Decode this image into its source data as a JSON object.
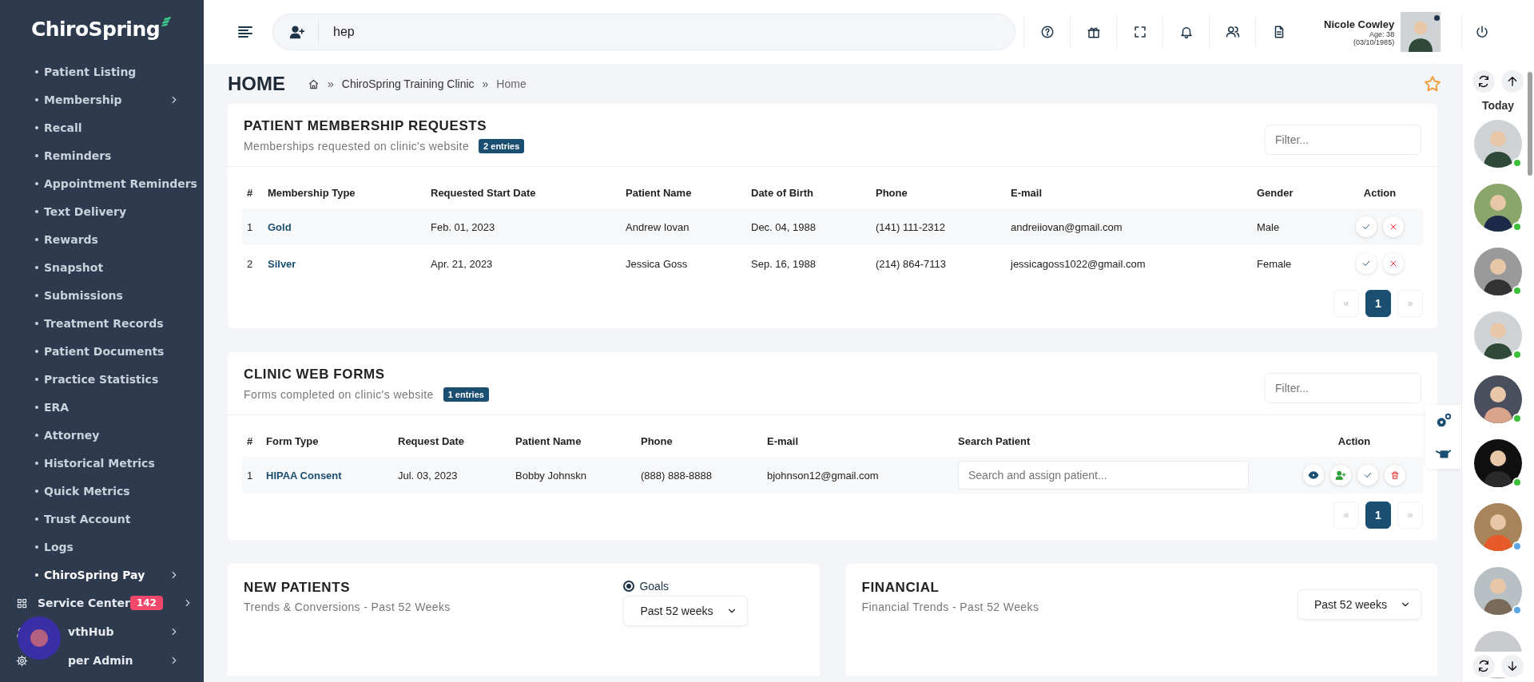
{
  "sidebar": {
    "logo": "ChiroSpring",
    "items": [
      {
        "kind": "sub",
        "label": "Patient Listing",
        "selected": false,
        "submenu": false
      },
      {
        "kind": "sub",
        "label": "Membership",
        "selected": false,
        "submenu": true
      },
      {
        "kind": "sub",
        "label": "Recall",
        "selected": false,
        "submenu": false
      },
      {
        "kind": "sub",
        "label": "Reminders",
        "selected": false,
        "submenu": false
      },
      {
        "kind": "sub",
        "label": "Appointment Reminders",
        "selected": false,
        "submenu": false
      },
      {
        "kind": "sub",
        "label": "Text Delivery",
        "selected": false,
        "submenu": false
      },
      {
        "kind": "sub",
        "label": "Rewards",
        "selected": false,
        "submenu": false
      },
      {
        "kind": "sub",
        "label": "Snapshot",
        "selected": false,
        "submenu": false
      },
      {
        "kind": "sub",
        "label": "Submissions",
        "selected": false,
        "submenu": false
      },
      {
        "kind": "sub",
        "label": "Treatment Records",
        "selected": false,
        "submenu": false
      },
      {
        "kind": "sub",
        "label": "Patient Documents",
        "selected": false,
        "submenu": false
      },
      {
        "kind": "sub",
        "label": "Practice Statistics",
        "selected": false,
        "submenu": false
      },
      {
        "kind": "sub",
        "label": "ERA",
        "selected": false,
        "submenu": false
      },
      {
        "kind": "sub",
        "label": "Attorney",
        "selected": false,
        "submenu": false
      },
      {
        "kind": "sub",
        "label": "Historical Metrics",
        "selected": false,
        "submenu": false
      },
      {
        "kind": "sub",
        "label": "Quick Metrics",
        "selected": false,
        "submenu": false
      },
      {
        "kind": "sub",
        "label": "Trust Account",
        "selected": false,
        "submenu": false
      },
      {
        "kind": "sub",
        "label": "Logs",
        "selected": false,
        "submenu": false
      },
      {
        "kind": "sub",
        "label": "ChiroSpring Pay",
        "selected": true,
        "submenu": true
      },
      {
        "kind": "grid",
        "label": "Service Center",
        "badge": "142",
        "selected": false,
        "submenu": true
      },
      {
        "kind": "person",
        "label": "vthHub",
        "selected": false,
        "submenu": true
      },
      {
        "kind": "gear",
        "label": "per Admin",
        "selected": false,
        "submenu": true
      }
    ]
  },
  "header": {
    "search": {
      "value": "hep"
    },
    "user": {
      "name": "Nicole Cowley",
      "age": "Age: 38",
      "dob": "(03/10/1985)"
    }
  },
  "page": {
    "title": "HOME",
    "breadcrumb": {
      "separator": "»",
      "items": [
        "ChiroSpring Training Clinic",
        "Home"
      ]
    }
  },
  "membership_requests": {
    "title": "PATIENT MEMBERSHIP REQUESTS",
    "subtitle": "Memberships requested on clinic's website",
    "badge": "2 entries",
    "filter": {
      "placeholder": "Filter..."
    },
    "columns": [
      "#",
      "Membership Type",
      "Requested Start Date",
      "Patient Name",
      "Date of Birth",
      "Phone",
      "E-mail",
      "Gender",
      "Action"
    ],
    "rows": [
      {
        "cells": [
          "1",
          "Gold",
          "Feb. 01, 2023",
          "Andrew Iovan",
          "Dec. 04, 1988",
          "(141) 111-2312",
          "andreiiovan@gmail.com",
          "Male"
        ]
      },
      {
        "cells": [
          "2",
          "Silver",
          "Apr. 21, 2023",
          "Jessica Goss",
          "Sep. 16, 1988",
          "(214) 864-7113",
          "jessicagoss1022@gmail.com",
          "Female"
        ]
      }
    ],
    "pagination": {
      "prev": "«",
      "next": "»",
      "pages": [
        {
          "label": "1",
          "selected": true
        }
      ]
    }
  },
  "web_forms": {
    "title": "CLINIC WEB FORMS",
    "subtitle": "Forms completed on clinic's website",
    "badge": "1 entries",
    "filter": {
      "placeholder": "Filter..."
    },
    "columns": [
      "#",
      "Form Type",
      "Request Date",
      "Patient Name",
      "Phone",
      "E-mail",
      "Search Patient",
      "Action"
    ],
    "rows": [
      {
        "cells": [
          "1",
          "HIPAA Consent",
          "Jul. 03, 2023",
          "Bobby Johnskn",
          "(888) 888-8888",
          "bjohnson12@gmail.com"
        ],
        "search": {
          "placeholder": "Search and assign patient..."
        }
      }
    ],
    "pagination": {
      "prev": "«",
      "next": "»",
      "pages": [
        {
          "label": "1",
          "selected": true
        }
      ]
    }
  },
  "new_patients": {
    "title": "NEW PATIENTS",
    "subtitle": "Trends & Conversions - Past 52 Weeks",
    "goals": {
      "label": "Goals",
      "checked": true
    },
    "period": "Past 52 weeks"
  },
  "financial": {
    "title": "FINANCIAL",
    "subtitle": "Financial Trends - Past 52 Weeks",
    "period": "Past 52 weeks"
  },
  "rail": {
    "label": "Today"
  }
}
